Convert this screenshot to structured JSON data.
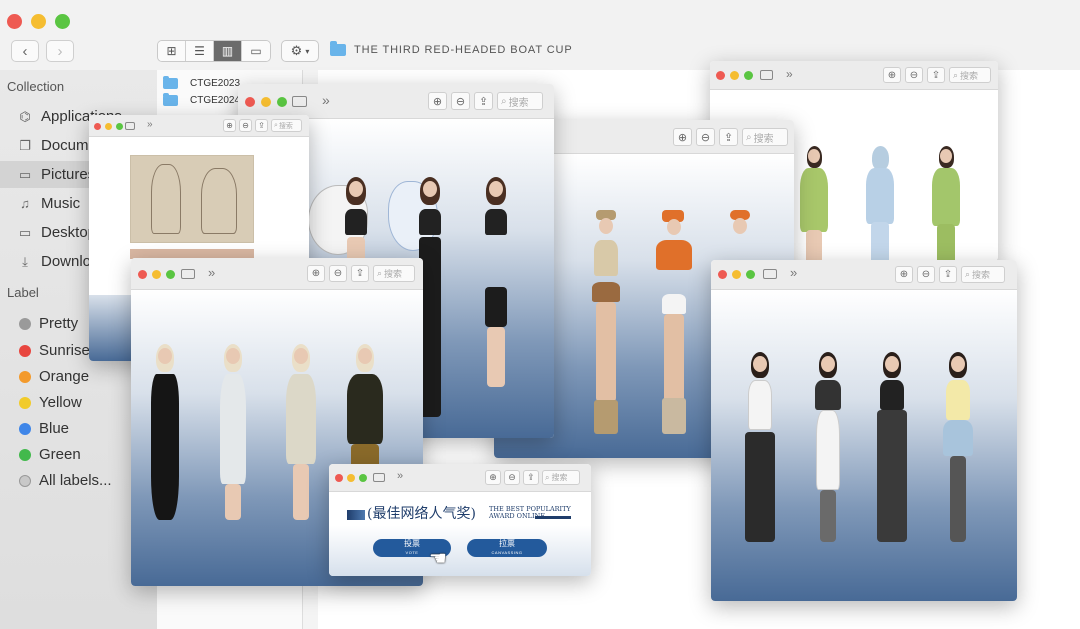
{
  "window": {
    "title": "THE THIRD RED-HEADED BOAT CUP",
    "nav_back": "‹",
    "nav_forward": "›",
    "view_modes": [
      "icon",
      "list",
      "column",
      "gallery"
    ],
    "active_view": "column"
  },
  "sidebar": {
    "collection_header": "Collection",
    "collection": [
      {
        "label": "Applications",
        "icon": "apps-icon"
      },
      {
        "label": "Documents",
        "icon": "document-icon"
      },
      {
        "label": "Pictures",
        "icon": "folder-icon",
        "selected": true
      },
      {
        "label": "Music",
        "icon": "music-icon"
      },
      {
        "label": "Desktop",
        "icon": "desktop-icon"
      },
      {
        "label": "Downloads",
        "icon": "download-icon"
      }
    ],
    "label_header": "Label",
    "labels": [
      {
        "label": "Pretty",
        "color": "#9a9a9a"
      },
      {
        "label": "Sunrise",
        "color": "#e8463f"
      },
      {
        "label": "Orange",
        "color": "#f39a2c"
      },
      {
        "label": "Yellow",
        "color": "#f1cb2a"
      },
      {
        "label": "Blue",
        "color": "#3f86e8"
      },
      {
        "label": "Green",
        "color": "#42b94c"
      },
      {
        "label": "All labels...",
        "color": "#c8c8c8"
      }
    ]
  },
  "column1": {
    "items": [
      "CTGE2023",
      "CTGE2024"
    ]
  },
  "preview": {
    "search_placeholder": "搜索"
  },
  "vote_card": {
    "title_cn": "(最佳网络人气奖)",
    "title_en_1": "THE BEST POPULARITY",
    "title_en_2": "AWARD ONLINE",
    "vote_label": "投票",
    "vote_sub": "VOTE",
    "canvass_label": "拉票",
    "canvass_sub": "CANVASSING"
  },
  "colors": {
    "accent_blue": "#235a9c",
    "stage_blue": "#486a96"
  }
}
